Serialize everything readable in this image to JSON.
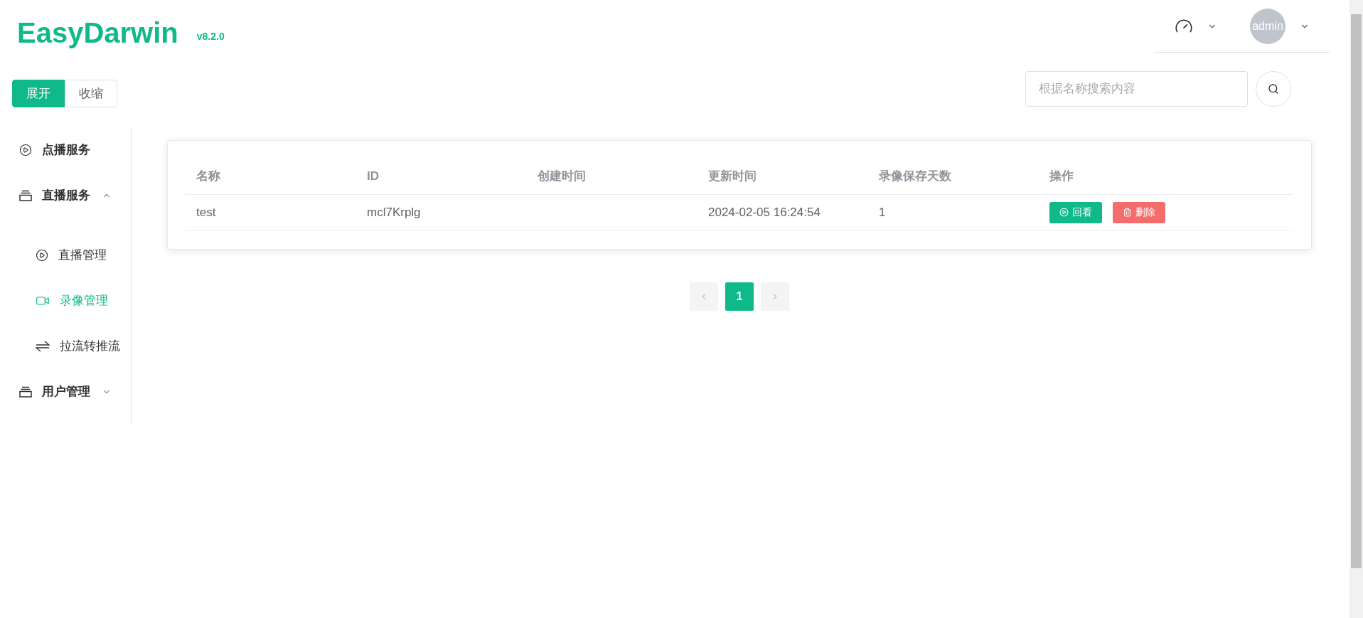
{
  "logo": {
    "name": "EasyDarwin",
    "version": "v8.2.0"
  },
  "header": {
    "user": "admin"
  },
  "toggle": [
    {
      "label": "展开",
      "selected": true
    },
    {
      "label": "收缩",
      "selected": false
    }
  ],
  "search": {
    "placeholder": "根据名称搜索内容"
  },
  "sidebar": {
    "items": [
      {
        "label": "点播服务",
        "kind": "play",
        "selected": false
      },
      {
        "label": "直播服务",
        "kind": "folder",
        "expanded": true,
        "children": [
          {
            "label": "直播管理",
            "kind": "play",
            "selected": false
          },
          {
            "label": "录像管理",
            "kind": "video",
            "selected": true
          },
          {
            "label": "拉流转推流",
            "kind": "swap",
            "selected": false
          }
        ]
      },
      {
        "label": "用户管理",
        "kind": "folder",
        "expanded": false
      }
    ]
  },
  "table": {
    "columns": [
      "名称",
      "ID",
      "创建时间",
      "更新时间",
      "录像保存天数",
      "操作"
    ],
    "rows": [
      {
        "cells": [
          "test",
          "mcl7Krplg",
          "",
          "2024-02-05 16:24:54",
          "1"
        ],
        "actions": [
          {
            "kind": "play",
            "label": "回看"
          },
          {
            "kind": "delete",
            "label": "删除"
          }
        ]
      }
    ]
  },
  "pagination": {
    "pages": [
      {
        "label": "1",
        "selected": true
      }
    ]
  }
}
